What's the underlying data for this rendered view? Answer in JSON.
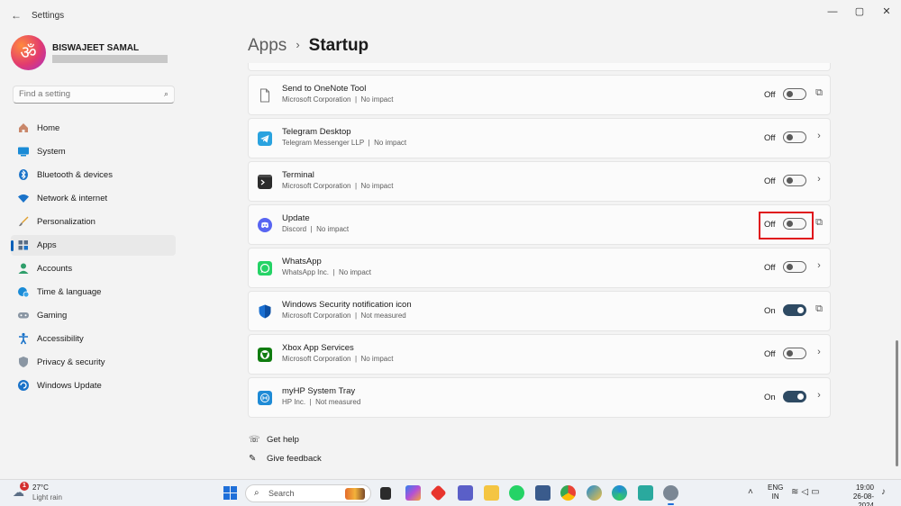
{
  "window": {
    "title": "Settings",
    "back_icon": "arrow-left-icon",
    "minimize": "—",
    "maximize": "▢",
    "close": "✕"
  },
  "profile": {
    "avatar_glyph": "ॐ",
    "name": "BISWAJEET SAMAL"
  },
  "search": {
    "placeholder": "Find a setting"
  },
  "nav": {
    "items": [
      {
        "label": "Home",
        "icon": "home-icon"
      },
      {
        "label": "System",
        "icon": "monitor-icon"
      },
      {
        "label": "Bluetooth & devices",
        "icon": "bluetooth-icon"
      },
      {
        "label": "Network & internet",
        "icon": "wifi-icon"
      },
      {
        "label": "Personalization",
        "icon": "brush-icon"
      },
      {
        "label": "Apps",
        "icon": "apps-icon",
        "active": true
      },
      {
        "label": "Accounts",
        "icon": "person-icon"
      },
      {
        "label": "Time & language",
        "icon": "globe-clock-icon"
      },
      {
        "label": "Gaming",
        "icon": "gamepad-icon"
      },
      {
        "label": "Accessibility",
        "icon": "accessibility-icon"
      },
      {
        "label": "Privacy & security",
        "icon": "shield-icon"
      },
      {
        "label": "Windows Update",
        "icon": "refresh-icon"
      }
    ]
  },
  "breadcrumb": {
    "parent": "Apps",
    "separator": "›",
    "current": "Startup"
  },
  "startup_apps": [
    {
      "name": "Send to OneNote Tool",
      "publisher": "Microsoft Corporation",
      "impact": "No impact",
      "state": "Off",
      "on": false,
      "action": "open-external-icon",
      "icon": "document-icon"
    },
    {
      "name": "Telegram Desktop",
      "publisher": "Telegram Messenger LLP",
      "impact": "No impact",
      "state": "Off",
      "on": false,
      "action": "chevron-right-icon",
      "icon": "telegram-icon"
    },
    {
      "name": "Terminal",
      "publisher": "Microsoft Corporation",
      "impact": "No impact",
      "state": "Off",
      "on": false,
      "action": "chevron-right-icon",
      "icon": "terminal-icon"
    },
    {
      "name": "Update",
      "publisher": "Discord",
      "impact": "No impact",
      "state": "Off",
      "on": false,
      "action": "open-external-icon",
      "icon": "discord-icon",
      "highlighted": true
    },
    {
      "name": "WhatsApp",
      "publisher": "WhatsApp Inc.",
      "impact": "No impact",
      "state": "Off",
      "on": false,
      "action": "chevron-right-icon",
      "icon": "whatsapp-icon"
    },
    {
      "name": "Windows Security notification icon",
      "publisher": "Microsoft Corporation",
      "impact": "Not measured",
      "state": "On",
      "on": true,
      "action": "open-external-icon",
      "icon": "windows-security-icon"
    },
    {
      "name": "Xbox App Services",
      "publisher": "Microsoft Corporation",
      "impact": "No impact",
      "state": "Off",
      "on": false,
      "action": "chevron-right-icon",
      "icon": "xbox-icon"
    },
    {
      "name": "myHP System Tray",
      "publisher": "HP Inc.",
      "impact": "Not measured",
      "state": "On",
      "on": true,
      "action": "chevron-right-icon",
      "icon": "myhp-icon"
    }
  ],
  "separator_char": "|",
  "help": {
    "get_help": "Get help",
    "give_feedback": "Give feedback"
  },
  "taskbar": {
    "weather_badge": "1",
    "weather_temp": "27°C",
    "weather_condition": "Light rain",
    "search_label": "Search",
    "language_line1": "ENG",
    "language_line2": "IN",
    "time": "19:00",
    "date": "26-08-2024"
  },
  "colors": {
    "accent": "#005fb8",
    "toggle_on": "#2e4a63",
    "highlight_box": "#e0141b"
  }
}
